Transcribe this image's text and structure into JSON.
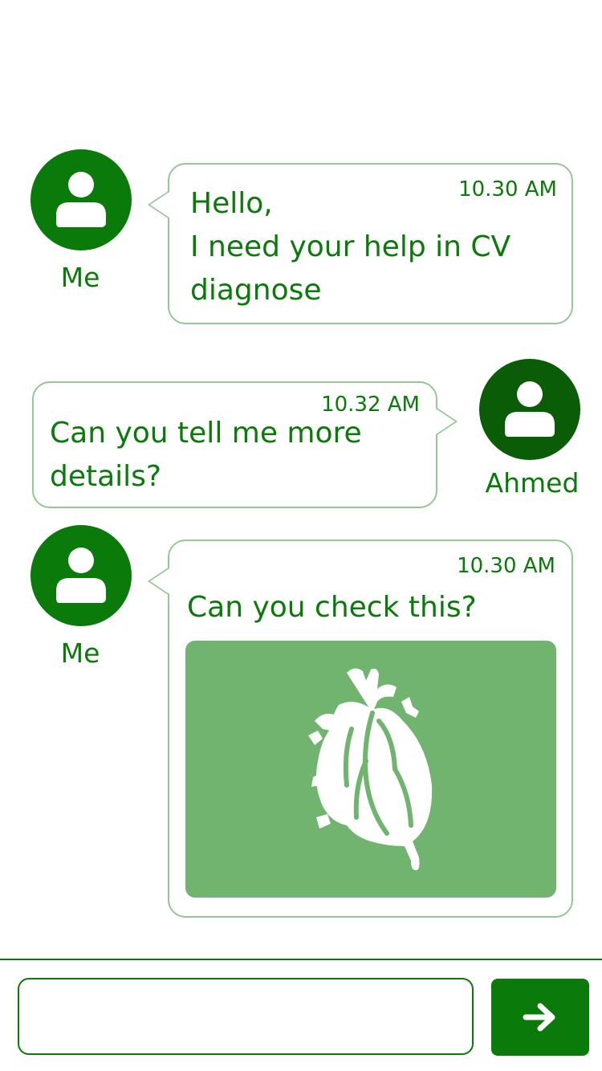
{
  "messages": [
    {
      "sender": "Me",
      "time": "10.30 AM",
      "text": "Hello,\nI need your help in CV diagnose"
    },
    {
      "sender": "Ahmed",
      "time": "10.32 AM",
      "text": "Can you tell me more details?"
    },
    {
      "sender": "Me",
      "time": "10.30 AM",
      "text": "Can you check this?",
      "attachment_icon": "heart-anatomy-icon"
    }
  ],
  "composer": {
    "value": "",
    "placeholder": "",
    "send_icon": "arrow-right-icon"
  },
  "colors": {
    "accent": "#0a7a0a",
    "accent_dark": "#0b5c06",
    "bubble_border": "#93c793",
    "image_bg": "#70b470"
  }
}
